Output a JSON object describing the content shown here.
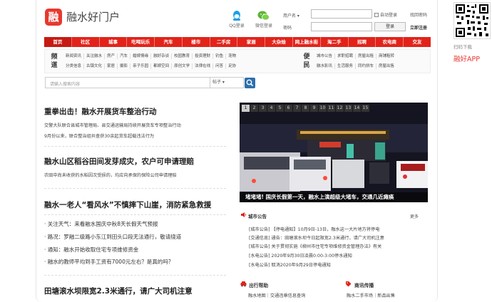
{
  "header": {
    "logo_char": "融",
    "site_title": "融水好门户",
    "qq_label": "QQ登录",
    "wechat_label": "微信登录",
    "user_label": "用户名 ▾",
    "pass_label": "密码",
    "auto_login": "自动登录",
    "find_pass": "找回密码",
    "login_btn": "登录",
    "register": "立即注册"
  },
  "nav": [
    "首页",
    "社区",
    "城事",
    "吃喝玩乐",
    "汽车",
    "楼市",
    "二手房",
    "家居",
    "大杂烩",
    "网上融水街",
    "淘二手",
    "招聘",
    "农电商",
    "交友"
  ],
  "channels": {
    "title_a": "频道",
    "row_a1": [
      "新闻资讯",
      "关注融水",
      "房产",
      "汽车",
      "婚嫁情缘",
      "融好杂谈",
      "校园教育",
      "投资理财",
      "钓鱼",
      "宠物"
    ],
    "row_a2": [
      "分类信息",
      "古镇文化",
      "家居",
      "摄影",
      "亲子乐园",
      "都嫁空间",
      "原创文学",
      "法律在线",
      "问答",
      "足协"
    ],
    "title_b": "便民",
    "row_b1": [
      "城市公告",
      "求职招聘",
      "房屋出租",
      "商铺租转"
    ],
    "row_b2": [
      "融水影讯",
      "生活服务",
      "同约拼车",
      "房屋出售"
    ]
  },
  "search": {
    "placeholder": "请输入搜索内容",
    "select": "帖子 ▾"
  },
  "news": {
    "h1": "重拳出击！融水开展货车整治行动",
    "h1_d1": "交警大队联合县城市管理局、县交通运输局持续开展货车专项整治行动",
    "h1_d2": "9月份以来，联合整治组共查获30余起货车超载违法行为",
    "h2": "融水山区稻谷田间发芽成灾，农户可申请理赔",
    "h2_d1": "农田中尚未收获的水稻因次受损的，均应向承保的保险公司申请理赔",
    "h3": "融水一老人“看风水”不慎摔下山崖，消防紧急救援",
    "b1": "· 关注天气：来看融水国庆中秋8天长假天气预报",
    "b2": "· 路况：罗融二级路小东江到田头口段无法通行，敬请绕道",
    "b3": "· 通知：融水开始收取住宅专项维修资金",
    "b4": "· 融水的教师平均到手工资有7000元左右？是真的吗？",
    "h4": "田塘滚水坝限宽2.3米通行，请广大司机注意"
  },
  "slideshow": {
    "numbers": [
      "1",
      "2",
      "3",
      "4",
      "5",
      "6",
      "7",
      "8",
      "9",
      "10",
      "11",
      "12",
      "13",
      "14",
      "15"
    ],
    "active": 1,
    "caption": "堵堵堵! 国庆长假第一天，融水上演超级大堵车，交通几近瘫痪"
  },
  "notices": {
    "title": "城市公告",
    "more": "更多",
    "items": [
      "[城市公告] 【停电通知】10月9日-13日，融水这一大片地方将停电",
      "[交通信息] 通告：田塘滚水坝今日起限宽2.3米通行，请广大司机注意",
      "[城市公告] 关于贯彻实施《柳州市住宅专项维修资金管理办法》有关",
      "[水电公告] 2020年9月30日凌晨0:00-3:00停水通知",
      "[水电公告] 取消2020年9月29日停电通知"
    ]
  },
  "help": {
    "title": "出行帮助",
    "text": "融水地图｜交通违章信息查询"
  },
  "trade": {
    "title": "商讯传播",
    "text": "融水二手市场｜新品出售"
  },
  "sidebar": {
    "qr_caption": "扫码下载",
    "app_link": "融好APP"
  },
  "colors": {
    "brand": "#e2231a",
    "accent": "#2f6fad"
  }
}
